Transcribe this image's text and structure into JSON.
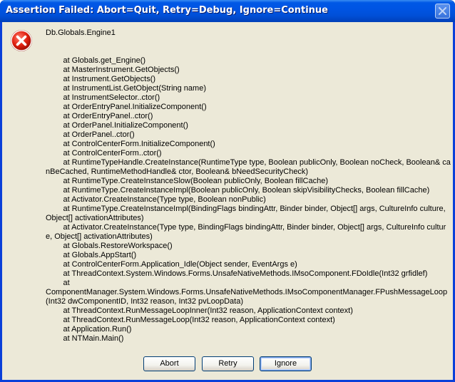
{
  "window": {
    "title": "Assertion Failed: Abort=Quit, Retry=Debug, Ignore=Continue"
  },
  "icon": "error-icon",
  "message": "Db.Globals.Engine1\n\n\n        at Globals.get_Engine()\n        at MasterInstrument.GetObjects()\n        at Instrument.GetObjects()\n        at InstrumentList.GetObject(String name)\n        at InstrumentSelector..ctor()\n        at OrderEntryPanel.InitializeComponent()\n        at OrderEntryPanel..ctor()\n        at OrderPanel.InitializeComponent()\n        at OrderPanel..ctor()\n        at ControlCenterForm.InitializeComponent()\n        at ControlCenterForm..ctor()\n        at RuntimeTypeHandle.CreateInstance(RuntimeType type, Boolean publicOnly, Boolean noCheck, Boolean& canBeCached, RuntimeMethodHandle& ctor, Boolean& bNeedSecurityCheck)\n        at RuntimeType.CreateInstanceSlow(Boolean publicOnly, Boolean fillCache)\n        at RuntimeType.CreateInstanceImpl(Boolean publicOnly, Boolean skipVisibilityChecks, Boolean fillCache)\n        at Activator.CreateInstance(Type type, Boolean nonPublic)\n        at RuntimeType.CreateInstanceImpl(BindingFlags bindingAttr, Binder binder, Object[] args, CultureInfo culture, Object[] activationAttributes)\n        at Activator.CreateInstance(Type type, BindingFlags bindingAttr, Binder binder, Object[] args, CultureInfo culture, Object[] activationAttributes)\n        at Globals.RestoreWorkspace()\n        at Globals.AppStart()\n        at ControlCenterForm.Application_Idle(Object sender, EventArgs e)\n        at ThreadContext.System.Windows.Forms.UnsafeNativeMethods.IMsoComponent.FDoIdle(Int32 grfidlef)\n        at\nComponentManager.System.Windows.Forms.UnsafeNativeMethods.IMsoComponentManager.FPushMessageLoop(Int32 dwComponentID, Int32 reason, Int32 pvLoopData)\n        at ThreadContext.RunMessageLoopInner(Int32 reason, ApplicationContext context)\n        at ThreadContext.RunMessageLoop(Int32 reason, ApplicationContext context)\n        at Application.Run()\n        at NTMain.Main()",
  "buttons": {
    "abort": "Abort",
    "retry": "Retry",
    "ignore": "Ignore"
  },
  "colors": {
    "titlebar": "#0054e3",
    "dialog_bg": "#ece9d8",
    "error_red": "#e02010"
  }
}
